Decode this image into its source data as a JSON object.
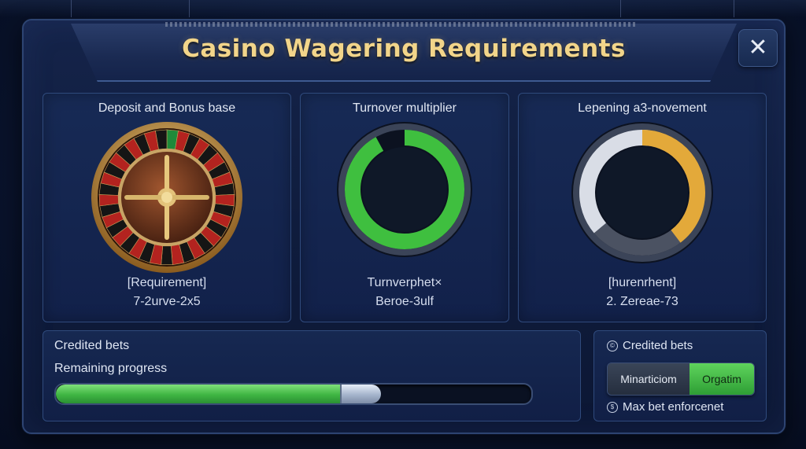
{
  "header": {
    "title": "Casino Wagering Requirements",
    "close_icon": "close-icon"
  },
  "cards": [
    {
      "title": "Deposit and Bonus base",
      "label": "[Requirement]",
      "value": "7-2urve-2x5",
      "visual": "roulette-wheel"
    },
    {
      "title": "Turnover multiplier",
      "label": "Turnverphet×",
      "value": "Beroe-3ulf",
      "visual": "progress-ring",
      "ring_color": "#3fbf3f",
      "ring_fraction": 0.92
    },
    {
      "title": "Lepening a3-novement",
      "label": "[hurenrhent]",
      "value": "2. Zereae-73",
      "visual": "progress-ring",
      "ring_colors": [
        "#d9dde6",
        "#e3a93a",
        "#4b5262"
      ],
      "ring_fraction": 0.72
    }
  ],
  "progress_panel": {
    "credited_label": "Credited bets",
    "remaining_label": "Remaining progress",
    "progress": 0.68,
    "fill_color": "#4fc64a"
  },
  "settings_panel": {
    "credited_label": "Credited bets",
    "credited_icon": "info-circle-icon",
    "toggle_off_label": "Minarticiom",
    "toggle_on_label": "Orgatim",
    "toggle_selected": "Orgatim",
    "max_bet_label": "Max bet enforcenet",
    "max_bet_icon": "dollar-circle-icon"
  }
}
